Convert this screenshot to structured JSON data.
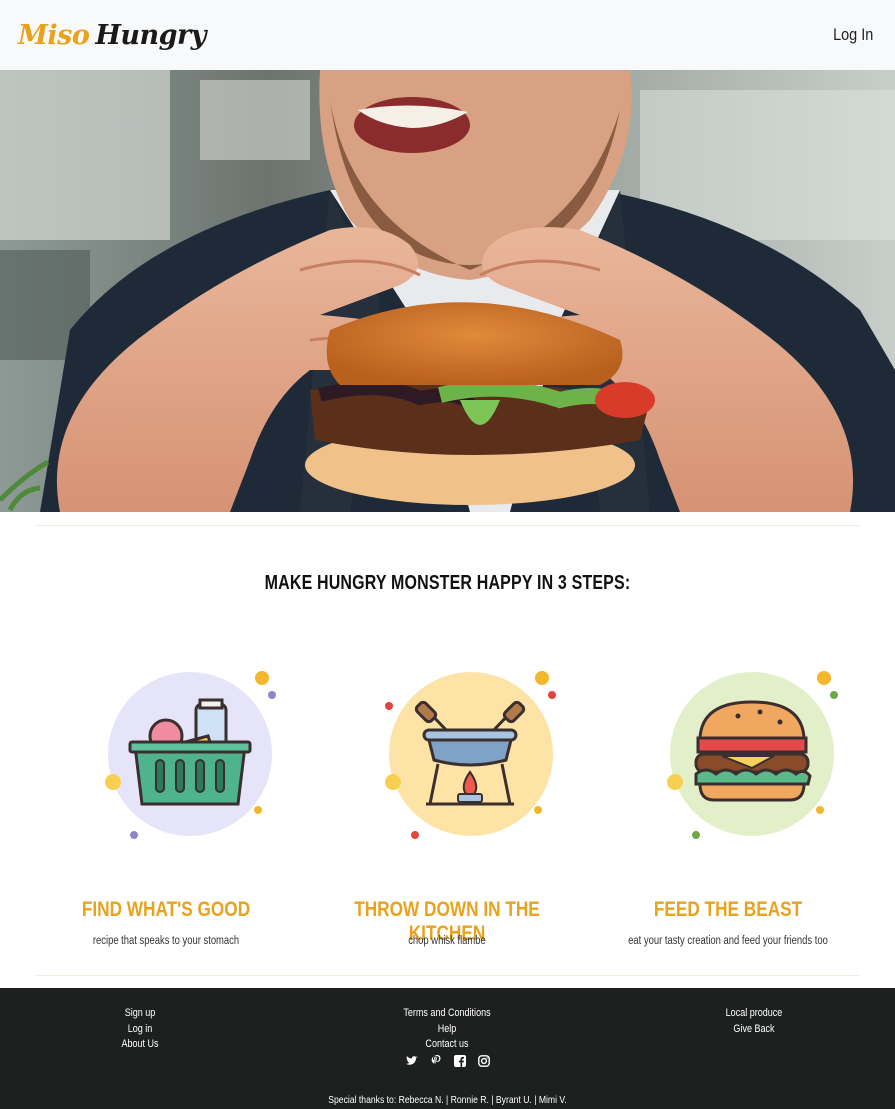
{
  "header": {
    "brand_first": "Miso",
    "brand_second": "Hungry",
    "login_label": "Log In"
  },
  "hero": {
    "image": "man-eating-burger-photo"
  },
  "steps": {
    "title": "MAKE HUNGRY MONSTER HAPPY IN 3 STEPS:",
    "items": [
      {
        "icon": "grocery-basket-icon",
        "heading": "FIND WHAT'S GOOD",
        "subtitle": "recipe that speaks to your stomach"
      },
      {
        "icon": "fondue-pot-icon",
        "heading": "THROW DOWN IN THE KITCHEN",
        "subtitle": "chop whisk flambe"
      },
      {
        "icon": "burger-icon",
        "heading": "FEED THE BEAST",
        "subtitle": "eat your tasty creation and feed your friends too"
      }
    ]
  },
  "footer": {
    "col1": [
      "Sign up",
      "Log in",
      "About Us"
    ],
    "col2": [
      "Terms and Conditions",
      "Help",
      "Contact us"
    ],
    "col3": [
      "Local produce",
      "Give Back"
    ],
    "social": [
      "twitter-icon",
      "pinterest-icon",
      "facebook-icon",
      "instagram-icon"
    ],
    "thanks": "Special thanks to: Rebecca N. | Ronnie R. | Byrant U. | Mimi V."
  },
  "colors": {
    "accent": "#e9a21c",
    "footer_bg": "#1e2020",
    "nav_bg": "#f8f9fa"
  }
}
